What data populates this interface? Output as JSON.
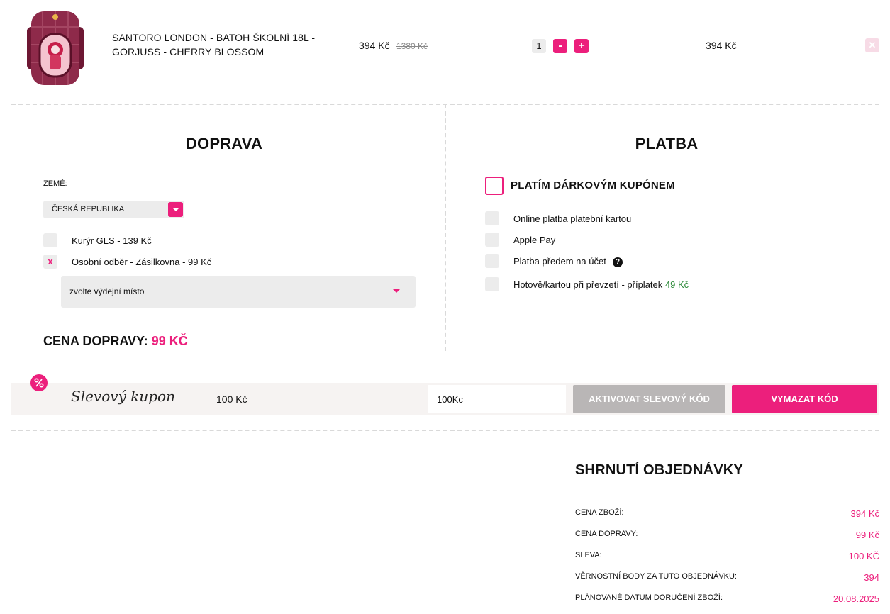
{
  "product": {
    "name": "SANTORO LONDON - BATOH ŠKOLNÍ 18L - GORJUSS - CHERRY BLOSSOM",
    "price": "394 Kč",
    "old_price": "1380 Kč",
    "quantity": "1",
    "minus_label": "-",
    "plus_label": "+",
    "total": "394 Kč",
    "remove_icon": "close-icon",
    "image_icon": "backpack-icon"
  },
  "shipping": {
    "title": "DOPRAVA",
    "country_label": "ZEMĚ:",
    "country_value": "ČESKÁ REPUBLIKA",
    "options": [
      {
        "label": "Kurýr GLS - 139 Kč",
        "checked": false,
        "mark": ""
      },
      {
        "label": "Osobní odběr - Zásilkovna - 99 Kč",
        "checked": true,
        "mark": "x"
      }
    ],
    "pickup_placeholder": "zvolte výdejní místo",
    "price_label": "CENA DOPRAVY:",
    "price_value": "99 KČ"
  },
  "payment": {
    "title": "PLATBA",
    "gift_label": "PLATÍM DÁRKOVÝM KUPÓNEM",
    "options": [
      {
        "label": "Online platba platební kartou"
      },
      {
        "label": "Apple Pay"
      },
      {
        "label": "Platba předem na účet"
      },
      {
        "label": "Hotově/kartou při převzetí - příplatek",
        "extra": "49 Kč"
      }
    ],
    "help_glyph": "?"
  },
  "coupon": {
    "title": "Slevový kupon",
    "value": "100 Kč",
    "input_value": "100Kc",
    "activate_label": "AKTIVOVAT SLEVOVÝ KÓD",
    "clear_label": "VYMAZAT KÓD"
  },
  "summary": {
    "title": "SHRNUTÍ OBJEDNÁVKY",
    "rows": [
      {
        "label": "CENA ZBOŽÍ:",
        "value": "394 Kč"
      },
      {
        "label": "CENA DOPRAVY:",
        "value": "99 Kč"
      },
      {
        "label": "SLEVA:",
        "value": "100 KČ"
      },
      {
        "label": "VĚRNOSTNÍ BODY ZA TUTO OBJEDNÁVKU:",
        "value": "394"
      },
      {
        "label": "PLÁNOVANÉ DATUM DORUČENÍ ZBOŽÍ:",
        "value": "20.08.2025"
      }
    ]
  },
  "colors": {
    "accent": "#ec1f7c",
    "green": "#2e8b3b",
    "muted_button": "#b9b6b6"
  }
}
